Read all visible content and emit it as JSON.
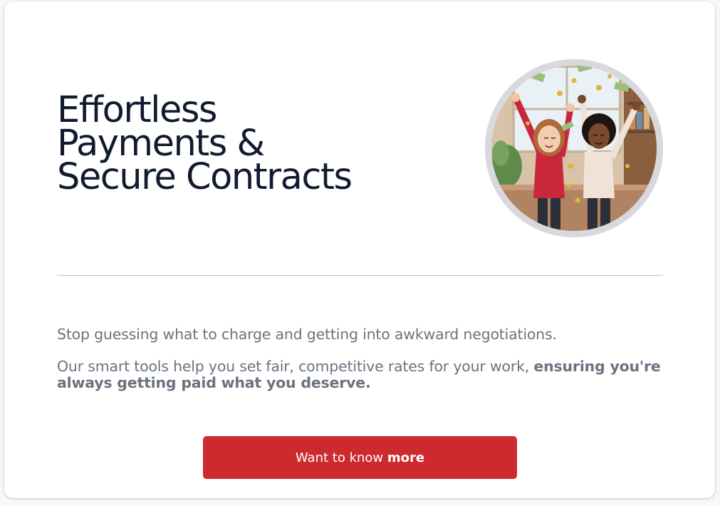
{
  "headline": {
    "line1": "Effortless",
    "line2": "Payments &",
    "line3": "Secure Contracts"
  },
  "hero_image": {
    "description_icon": "celebrating-women-illustration"
  },
  "body": {
    "paragraph1": "Stop guessing what to charge and getting into awkward negotiations.",
    "paragraph2_regular": "Our smart tools help you set fair, competitive rates for your work, ",
    "paragraph2_bold": "ensuring you're always getting paid what you deserve."
  },
  "cta": {
    "label_regular": "Want to know ",
    "label_bold": "more"
  },
  "colors": {
    "accent": "#cd2a2e",
    "headline": "#111a2e",
    "body_text": "#6b7280",
    "divider": "#c4c4c4"
  }
}
